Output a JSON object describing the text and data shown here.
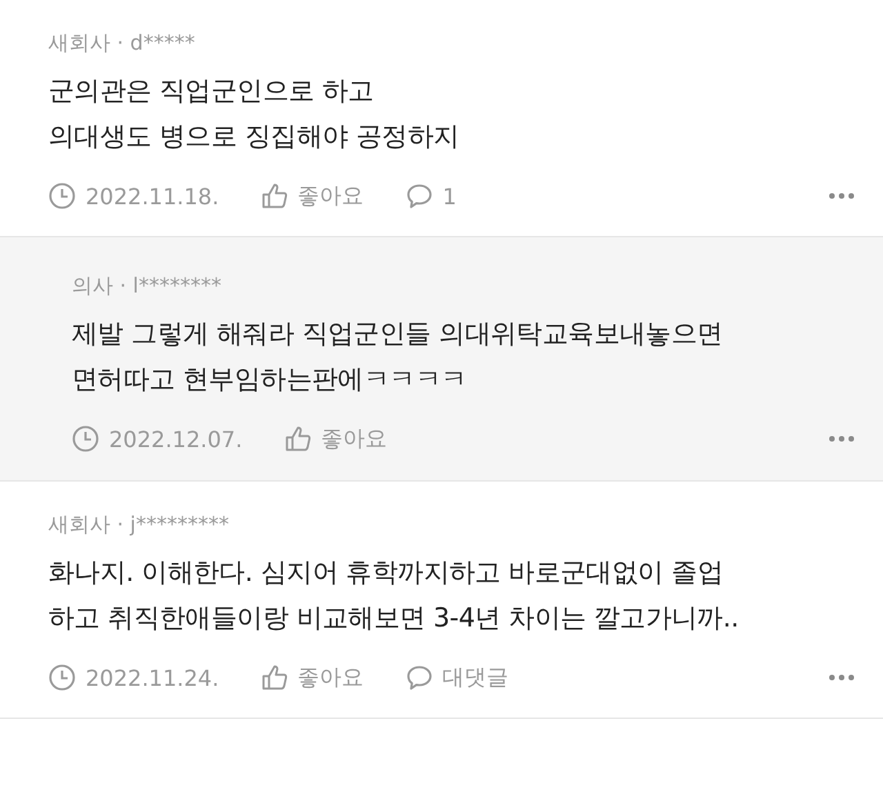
{
  "comments": [
    {
      "kind": "comment",
      "author": "새회사 · d*****",
      "body": "군의관은 직업군인으로 하고\n의대생도 병으로 징집해야 공정하지",
      "date": "2022.11.18.",
      "like_label": "좋아요",
      "reply_label": "1"
    },
    {
      "kind": "reply",
      "author": "의사 · l********",
      "body": "제발 그렇게 해줘라 직업군인들 의대위탁교육보내놓으면\n면허따고 현부임하는판에ㅋㅋㅋㅋ",
      "date": "2022.12.07.",
      "like_label": "좋아요"
    },
    {
      "kind": "comment",
      "author": "새회사 · j*********",
      "body": "화나지. 이해한다. 심지어 휴학까지하고 바로군대없이 졸업\n하고 취직한애들이랑 비교해보면 3-4년 차이는 깔고가니까..",
      "date": "2022.11.24.",
      "like_label": "좋아요",
      "reply_label": "대댓글"
    }
  ]
}
